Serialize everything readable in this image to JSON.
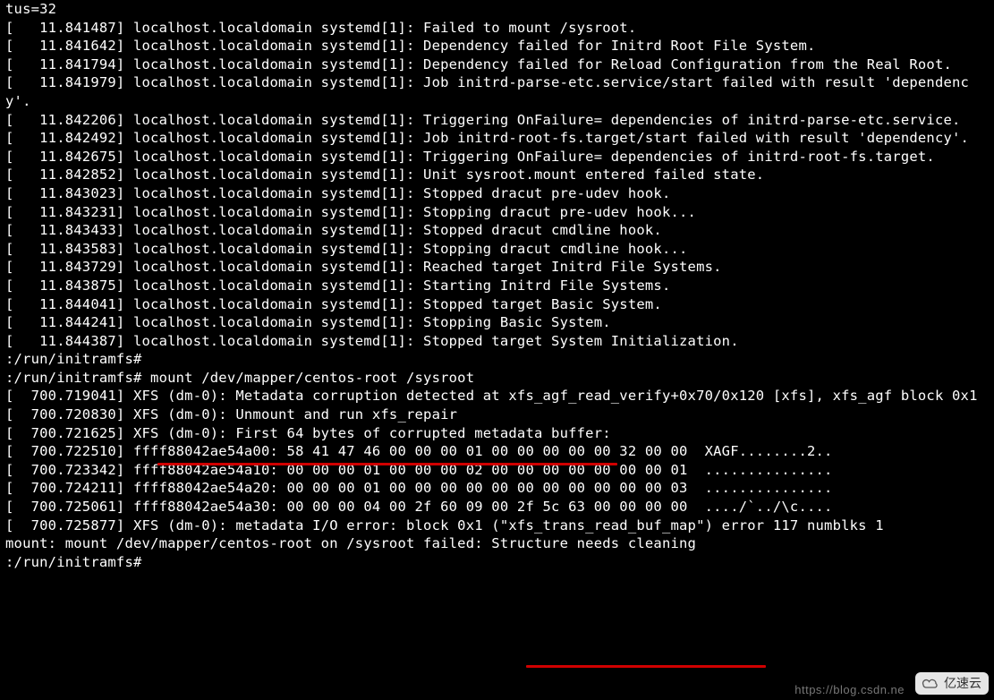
{
  "terminal": {
    "text": "tus=32\n[   11.841487] localhost.localdomain systemd[1]: Failed to mount /sysroot.\n[   11.841642] localhost.localdomain systemd[1]: Dependency failed for Initrd Root File System.\n[   11.841794] localhost.localdomain systemd[1]: Dependency failed for Reload Configuration from the Real Root.\n[   11.841979] localhost.localdomain systemd[1]: Job initrd-parse-etc.service/start failed with result 'dependency'.\n[   11.842206] localhost.localdomain systemd[1]: Triggering OnFailure= dependencies of initrd-parse-etc.service.\n[   11.842492] localhost.localdomain systemd[1]: Job initrd-root-fs.target/start failed with result 'dependency'.\n[   11.842675] localhost.localdomain systemd[1]: Triggering OnFailure= dependencies of initrd-root-fs.target.\n[   11.842852] localhost.localdomain systemd[1]: Unit sysroot.mount entered failed state.\n[   11.843023] localhost.localdomain systemd[1]: Stopped dracut pre-udev hook.\n[   11.843231] localhost.localdomain systemd[1]: Stopping dracut pre-udev hook...\n[   11.843433] localhost.localdomain systemd[1]: Stopped dracut cmdline hook.\n[   11.843583] localhost.localdomain systemd[1]: Stopping dracut cmdline hook...\n[   11.843729] localhost.localdomain systemd[1]: Reached target Initrd File Systems.\n[   11.843875] localhost.localdomain systemd[1]: Starting Initrd File Systems.\n[   11.844041] localhost.localdomain systemd[1]: Stopped target Basic System.\n[   11.844241] localhost.localdomain systemd[1]: Stopping Basic System.\n[   11.844387] localhost.localdomain systemd[1]: Stopped target System Initialization.\n:/run/initramfs#\n:/run/initramfs# mount /dev/mapper/centos-root /sysroot\n[  700.719041] XFS (dm-0): Metadata corruption detected at xfs_agf_read_verify+0x70/0x120 [xfs], xfs_agf block 0x1\n[  700.720830] XFS (dm-0): Unmount and run xfs_repair\n[  700.721625] XFS (dm-0): First 64 bytes of corrupted metadata buffer:\n[  700.722510] ffff88042ae54a00: 58 41 47 46 00 00 00 01 00 00 00 00 00 32 00 00  XAGF........2..\n[  700.723342] ffff88042ae54a10: 00 00 00 01 00 00 00 02 00 00 00 00 00 00 00 01  ...............\n[  700.724211] ffff88042ae54a20: 00 00 00 01 00 00 00 00 00 00 00 00 00 00 00 03  ...............\n[  700.725061] ffff88042ae54a30: 00 00 00 04 00 2f 60 09 00 2f 5c 63 00 00 00 00  ..../`../\\c....\n[  700.725877] XFS (dm-0): metadata I/O error: block 0x1 (\"xfs_trans_read_buf_map\") error 117 numblks 1\nmount: mount /dev/mapper/centos-root on /sysroot failed: Structure needs cleaning\n:/run/initramfs#\n"
  },
  "annotations": {
    "underline1": "mount /dev/mapper/centos-root /sysroot",
    "underline2": "Structure needs cleaning"
  },
  "watermark": {
    "text": "https://blog.csdn.ne",
    "logo_text": "亿速云"
  }
}
